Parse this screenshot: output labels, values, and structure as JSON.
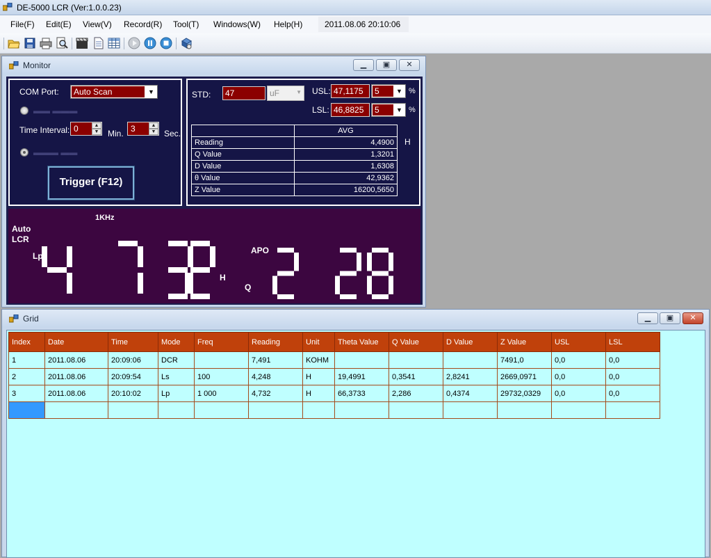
{
  "app": {
    "title": "DE-5000 LCR (Ver:1.0.0.23)"
  },
  "menu": {
    "items": [
      "File(F)",
      "Edit(E)",
      "View(V)",
      "Record(R)",
      "Tool(T)",
      "Windows(W)",
      "Help(H)"
    ],
    "clock": "2011.08.06 20:10:06"
  },
  "toolbar": {
    "icons": [
      "open-folder-icon",
      "save-icon",
      "print-icon",
      "print-preview-icon",
      "clapperboard-icon",
      "document-icon",
      "table-icon",
      "play-icon",
      "pause-icon",
      "stop-icon",
      "connect-icon"
    ]
  },
  "monitor": {
    "title": "Monitor",
    "com_port_label": "COM Port:",
    "com_port_value": "Auto Scan",
    "time_interval_label": "Time Interval:",
    "min_value": "0",
    "min_label": "Min.",
    "sec_value": "3",
    "sec_label": "Sec.",
    "trigger_label": "Trigger (F12)",
    "std_label": "STD:",
    "std_value": "47",
    "std_unit": "uF",
    "usl_label": "USL:",
    "usl_value": "47,1175",
    "usl_pct": "5",
    "lsl_label": "LSL:",
    "lsl_value": "46,8825",
    "lsl_pct": "5",
    "percent": "%",
    "avg_header": "AVG",
    "avg_unit": "H",
    "avg_rows": [
      {
        "label": "Reading",
        "value": "4,4900"
      },
      {
        "label": "Q Value",
        "value": "1,3201"
      },
      {
        "label": "D Value",
        "value": "1,6308"
      },
      {
        "label": "θ Value",
        "value": "42,9362"
      },
      {
        "label": "Z Value",
        "value": "16200,5650"
      }
    ],
    "lcd": {
      "freq": "1KHz",
      "auto": "Auto",
      "lcr": "LCR",
      "mode": "Lp",
      "primary_digits": "4732",
      "primary_unit": "H",
      "apo": "APO",
      "secondary_label": "Q",
      "secondary_digits": "228"
    }
  },
  "grid": {
    "title": "Grid",
    "columns": [
      "Index",
      "Date",
      "Time",
      "Mode",
      "Freq",
      "Reading",
      "Unit",
      "Theta Value",
      "Q Value",
      "D Value",
      "Z Value",
      "USL",
      "LSL"
    ],
    "rows": [
      [
        "1",
        "2011.08.06",
        "20:09:06",
        "DCR",
        "",
        "7,491",
        "KOHM",
        "",
        "",
        "",
        "7491,0",
        "0,0",
        "0,0"
      ],
      [
        "2",
        "2011.08.06",
        "20:09:54",
        "Ls",
        "100",
        "4,248",
        "H",
        "19,4991",
        "0,3541",
        "2,8241",
        "2669,0971",
        "0,0",
        "0,0"
      ],
      [
        "3",
        "2011.08.06",
        "20:10:02",
        "Lp",
        "1 000",
        "4,732",
        "H",
        "66,3733",
        "2,286",
        "0,4374",
        "29732,0329",
        "0,0",
        "0,0"
      ]
    ]
  },
  "colors": {
    "panel_bg": "#151546",
    "lcd_bg": "#3c0640",
    "grid_header": "#c0410b",
    "grid_bg": "#bfffff",
    "input_red": "#8b0000"
  }
}
